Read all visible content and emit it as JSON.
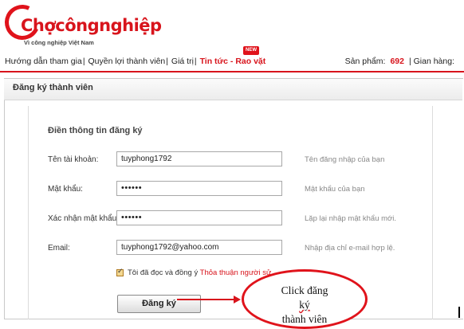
{
  "logo": {
    "text": "Chợcôngnghiệp",
    "subtitle": "Vì công nghiệp Việt Nam"
  },
  "nav": {
    "items": [
      "Hướng dẫn tham gia",
      "Quyền lợi thành viên",
      "Giá trị"
    ],
    "hot": "Tin tức - Rao vặt"
  },
  "stats": {
    "products_label": "Sản phẩm:",
    "products_count": "692",
    "shops_label": "| Gian hàng:"
  },
  "panel": {
    "title": "Đăng ký thành viên",
    "section": "Điền thông tin đăng ký"
  },
  "form": {
    "username": {
      "label": "Tên tài khoản:",
      "value": "tuyphong1792",
      "hint": "Tên đăng nhập của bạn"
    },
    "password": {
      "label": "Mật khẩu:",
      "value": "••••••",
      "hint": "Mật khẩu của bạn"
    },
    "confirm": {
      "label": "Xác nhận mật khẩu:",
      "value": "••••••",
      "hint": "Lặp lại nhập mật khẩu mới."
    },
    "email": {
      "label": "Email:",
      "value": "tuyphong1792@yahoo.com",
      "hint": "Nhập địa chỉ e-mail hợp lệ."
    },
    "agree_text": "Tôi đã đọc và đồng ý",
    "agree_link": "Thỏa thuận người sử",
    "submit_label": "Đăng ký"
  },
  "callout": {
    "line1": "Click đăng",
    "line2a": "ký",
    "line2b": "thành viên"
  },
  "colors": {
    "accent": "#d8141c"
  }
}
